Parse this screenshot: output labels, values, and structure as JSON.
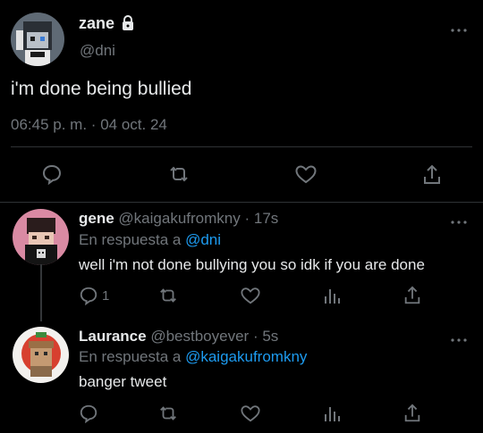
{
  "main_tweet": {
    "name": "zane",
    "handle": "@dni",
    "text": "i'm done being bullied",
    "time": "06:45 p. m.",
    "separator": "·",
    "date": "04 oct. 24",
    "icons": [
      "lock-icon",
      "more-icon",
      "reply-icon",
      "retweet-icon",
      "like-icon",
      "share-icon"
    ]
  },
  "replies": [
    {
      "name": "gene",
      "handle": "@kaigakufromkny",
      "separator": "·",
      "time": "17s",
      "reply_prefix": "En respuesta a",
      "reply_to": "@dni",
      "text": "well i'm not done bullying you so idk if you are done",
      "reply_count": "1"
    },
    {
      "name": "Laurance",
      "handle": "@bestboyever",
      "separator": "·",
      "time": "5s",
      "reply_prefix": "En respuesta a",
      "reply_to": "@kaigakufromkny",
      "text": "banger tweet",
      "reply_count": ""
    }
  ],
  "colors": {
    "background": "#000000",
    "text": "#e7e9ea",
    "muted": "#71767b",
    "link": "#1d9bf0",
    "divider": "#2f3336"
  }
}
